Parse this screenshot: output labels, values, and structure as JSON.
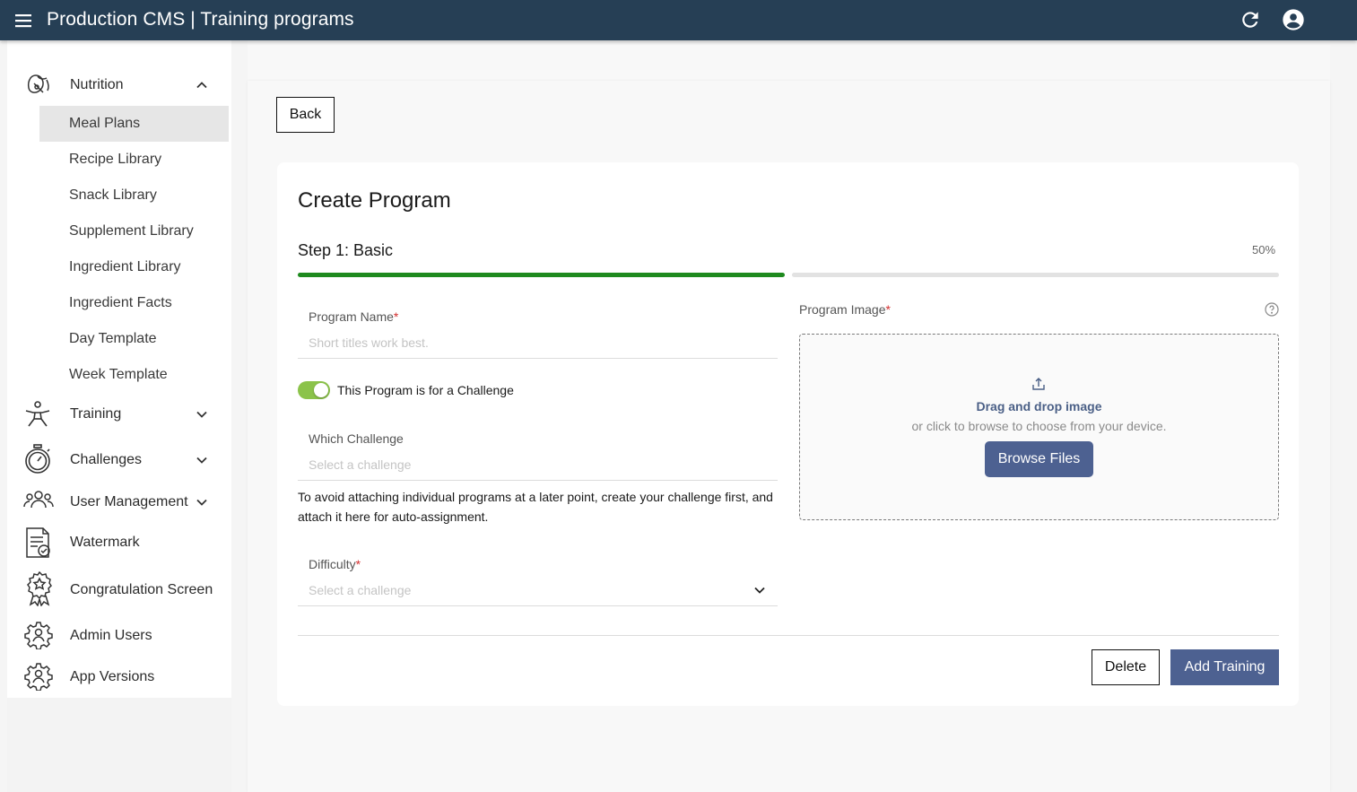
{
  "topbar": {
    "title": "Production CMS | Training programs",
    "menu_icon": "hamburger-icon",
    "refresh_icon": "refresh-icon",
    "account_icon": "account-circle-icon",
    "bg_color": "#263f55"
  },
  "sidebar": {
    "nutrition": {
      "label": "Nutrition",
      "icon": "nutrition-icon",
      "expanded": true
    },
    "nutrition_items": [
      {
        "label": "Meal Plans",
        "active": true
      },
      {
        "label": "Recipe Library"
      },
      {
        "label": "Snack Library"
      },
      {
        "label": "Supplement Library"
      },
      {
        "label": "Ingredient Library"
      },
      {
        "label": "Ingredient Facts"
      },
      {
        "label": "Day Template"
      },
      {
        "label": "Week Template"
      }
    ],
    "training": {
      "label": "Training",
      "icon": "training-icon"
    },
    "challenges": {
      "label": "Challenges",
      "icon": "stopwatch-icon"
    },
    "user_management": {
      "label": "User Management",
      "icon": "users-icon"
    },
    "watermark": {
      "label": "Watermark",
      "icon": "document-check-icon"
    },
    "congratulation": {
      "label": "Congratulation Screen",
      "icon": "award-icon"
    },
    "admin_users": {
      "label": "Admin Users",
      "icon": "gear-user-icon"
    },
    "app_versions": {
      "label": "App Versions",
      "icon": "gear-user-icon"
    }
  },
  "main": {
    "back_label": "Back",
    "title": "Create Program",
    "step_label": "Step 1: Basic",
    "progress_text": "50%",
    "progress_fraction": 0.5,
    "program_name": {
      "label": "Program Name",
      "required": "*",
      "placeholder": "Short titles work best.",
      "value": ""
    },
    "challenge_toggle": {
      "label": "This Program is for a Challenge",
      "on": true,
      "color": "#8bc34a"
    },
    "which_challenge": {
      "label": "Which Challenge",
      "placeholder": "Select a challenge"
    },
    "help_text": "To avoid attaching individual programs at a later point, create your challenge first, and attach it here for auto-assignment.",
    "difficulty": {
      "label": "Difficulty",
      "required": "*",
      "placeholder": "Select a challenge"
    },
    "program_image": {
      "label": "Program Image",
      "required": "*",
      "dz_title": "Drag and drop image",
      "dz_sub": "or click to browse to choose from your device.",
      "browse_label": "Browse Files"
    },
    "delete_label": "Delete",
    "add_training_label": "Add Training",
    "accent_color": "#4d6191",
    "progress_color": "#1e8a1e"
  }
}
